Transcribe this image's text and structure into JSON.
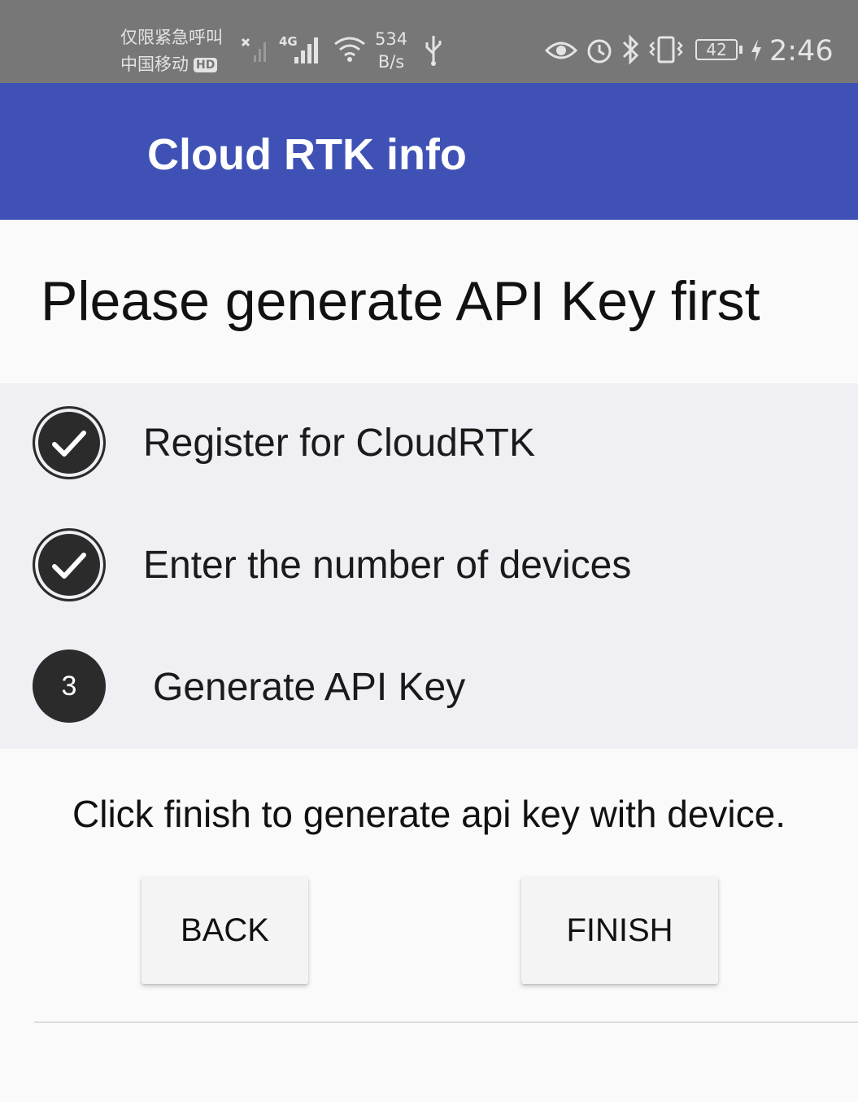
{
  "status_bar": {
    "line1": "仅限紧急呼叫",
    "carrier": "中国移动",
    "hd_badge": "HD",
    "network_type": "4G",
    "speed_value": "534",
    "speed_unit": "B/s",
    "battery": "42",
    "time": "2:46",
    "icons": [
      "no-sim-x-icon",
      "signal-icon",
      "signal-4g-icon",
      "wifi-icon",
      "usb-icon",
      "eye-icon",
      "alarm-icon",
      "bluetooth-icon",
      "vibrate-icon",
      "battery-icon",
      "charging-icon"
    ]
  },
  "appbar": {
    "title": "Cloud RTK info",
    "color": "#3f51b5"
  },
  "main": {
    "heading": "Please generate API Key first",
    "steps": [
      {
        "label": "Register for CloudRTK",
        "state": "completed",
        "icon": "checkmark-icon"
      },
      {
        "label": "Enter the number of devices",
        "state": "completed",
        "icon": "checkmark-icon"
      },
      {
        "label": "Generate API Key",
        "state": "current",
        "number": "3"
      }
    ],
    "instruction": "Click finish to generate api key with device.",
    "buttons": {
      "back_label": "BACK",
      "finish_label": "FINISH"
    }
  }
}
